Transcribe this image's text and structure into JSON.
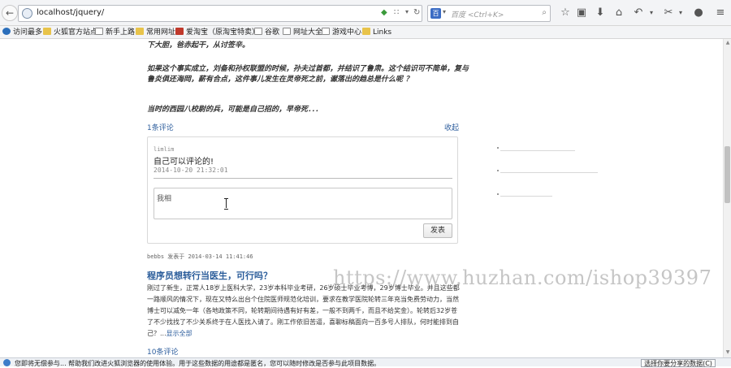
{
  "browser": {
    "url": "localhost/jquery/",
    "search_placeholder": "百度 <Ctrl+K>"
  },
  "bookmarks": [
    {
      "label": "访问最多",
      "icon": "gear-icon"
    },
    {
      "label": "火狐官方站点",
      "icon": "folder-icon"
    },
    {
      "label": "新手上路",
      "icon": "page-icon"
    },
    {
      "label": "常用网址",
      "icon": "folder-icon"
    },
    {
      "label": "爱淘宝（原淘宝特卖）",
      "icon": "taobao-icon"
    },
    {
      "label": "谷歌",
      "icon": "page-icon"
    },
    {
      "label": "网址大全",
      "icon": "page-icon"
    },
    {
      "label": "游戏中心",
      "icon": "page-icon"
    },
    {
      "label": "Links",
      "icon": "folder-icon"
    }
  ],
  "article": {
    "line_top": "下大胆，爸赤起干，从讨签辛。",
    "line_1": "如果这个事实成立，刘备和孙权联盟的时候，孙夫过首都，并结识了鲁肃。这个结识可不简单，复与",
    "line_2": "鲁炎俱还海岡，薪有合点，这件事儿发生在灵帝死之前，谳落出的趋总是什么呢 ？",
    "line_3": "当时的西园八校尉的兵，可能是自己招的，早帝死．．．"
  },
  "comments_link": "1条评论",
  "collapse_link": "收起",
  "comment": {
    "user": "limlim",
    "text": "自己可以评论的!",
    "time": "2014-10-20 21:32:01"
  },
  "reply_input_value": "我相",
  "submit_label": "发表",
  "post_meta": "bebbs 发表于 2014-03-14 11:41:46",
  "post_title": "程序员想转行当医生，可行吗？",
  "post_body_lines": [
    "刚过了新生，正常人18岁上医科大学，23岁本科毕业考研，26岁硕士毕业考博，29岁博士毕业。并且这些都是",
    "一路顺风的情况下，现在又特么出台个住院医师规范化培训，要求在教学医院轮转三年充当免费劳动力，当然",
    "博士可以减免一年（各地政策不同，轮转期间待遇有好有差，一般不到两千，而且不给奖金）。轮转后32岁苍",
    "了不少找找了不少关系终于在人医找入请了。刚工作依旧苦逼，喜聊标稿面向一百多号人排队，何时能排到自"
  ],
  "post_last_line": "己？...",
  "show_all": "显示全部",
  "post_comments_link": "10条评论",
  "watermark": "https://www.huzhan.com/ishop39397",
  "notification": {
    "text": "您即将无偿参与...  帮助我们改进火狐浏览器的使用体验。用于这些数据的用途都是匿名，您可以随时修改是否参与此项目数据。",
    "button": "选择你要分享的数据(C)"
  }
}
